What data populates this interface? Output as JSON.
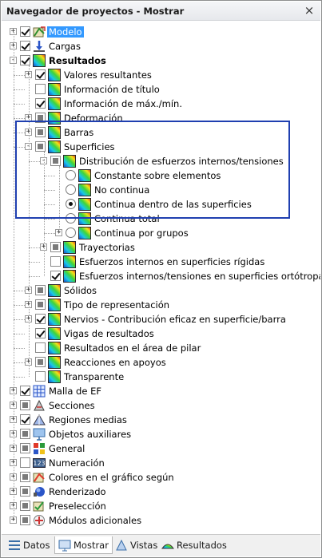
{
  "window": {
    "title": "Navegador de proyectos - Mostrar",
    "close_glyph": "×"
  },
  "tree": [
    {
      "label": "Modelo",
      "level": 0,
      "expander": "+",
      "check": "checked",
      "icon": "model-icon",
      "selected": true
    },
    {
      "label": "Cargas",
      "level": 0,
      "expander": "+",
      "check": "checked",
      "icon": "loads-icon"
    },
    {
      "label": "Resultados",
      "level": 0,
      "expander": "-",
      "check": "checked",
      "icon": "results-icon",
      "bold": true
    },
    {
      "label": "Valores resultantes",
      "level": 1,
      "expander": "+",
      "check": "checked",
      "icon": "rainbow-icon"
    },
    {
      "label": "Información de título",
      "level": 1,
      "expander": "",
      "check": "unchecked",
      "icon": "rainbow-icon"
    },
    {
      "label": "Información de máx./mín.",
      "level": 1,
      "expander": "",
      "check": "checked",
      "icon": "rainbow-icon"
    },
    {
      "label": "Deformación",
      "level": 1,
      "expander": "+",
      "check": "partial",
      "icon": "rainbow-icon"
    },
    {
      "label": "Barras",
      "level": 1,
      "expander": "+",
      "check": "partial",
      "icon": "rainbow-icon"
    },
    {
      "label": "Superficies",
      "level": 1,
      "expander": "-",
      "check": "partial",
      "icon": "rainbow-icon"
    },
    {
      "label": "Distribución de esfuerzos internos/tensiones",
      "level": 2,
      "expander": "-",
      "check": "partial",
      "icon": "rainbow-icon"
    },
    {
      "label": "Constante sobre elementos",
      "level": 3,
      "expander": "",
      "radio": "off",
      "icon": "rainbow-icon"
    },
    {
      "label": "No continua",
      "level": 3,
      "expander": "",
      "radio": "off",
      "icon": "rainbow-icon"
    },
    {
      "label": "Continua dentro de las superficies",
      "level": 3,
      "expander": "",
      "radio": "on",
      "icon": "rainbow-icon"
    },
    {
      "label": "Continua total",
      "level": 3,
      "expander": "",
      "radio": "off",
      "icon": "rainbow-icon"
    },
    {
      "label": "Continua por grupos",
      "level": 3,
      "expander": "+",
      "radio": "off",
      "icon": "rainbow-icon"
    },
    {
      "label": "Trayectorias",
      "level": 2,
      "expander": "+",
      "check": "partial",
      "icon": "rainbow-icon"
    },
    {
      "label": "Esfuerzos internos en superficies rígidas",
      "level": 2,
      "expander": "",
      "check": "unchecked",
      "icon": "rainbow-icon"
    },
    {
      "label": "Esfuerzos internos/tensiones en superficies ortótropas",
      "level": 2,
      "expander": "",
      "check": "checked",
      "icon": "rainbow-icon"
    },
    {
      "label": "Sólidos",
      "level": 1,
      "expander": "+",
      "check": "partial",
      "icon": "rainbow-icon"
    },
    {
      "label": "Tipo de representación",
      "level": 1,
      "expander": "+",
      "check": "partial",
      "icon": "rainbow-icon"
    },
    {
      "label": "Nervios - Contribución eficaz en superficie/barra",
      "level": 1,
      "expander": "+",
      "check": "checked",
      "icon": "rainbow-icon"
    },
    {
      "label": "Vigas de resultados",
      "level": 1,
      "expander": "",
      "check": "checked",
      "icon": "rainbow-icon"
    },
    {
      "label": "Resultados en el área de pilar",
      "level": 1,
      "expander": "",
      "check": "unchecked",
      "icon": "rainbow-icon"
    },
    {
      "label": "Reacciones en apoyos",
      "level": 1,
      "expander": "+",
      "check": "partial",
      "icon": "rainbow-icon"
    },
    {
      "label": "Transparente",
      "level": 1,
      "expander": "",
      "check": "unchecked",
      "icon": "rainbow-icon"
    },
    {
      "label": "Malla de EF",
      "level": 0,
      "expander": "+",
      "check": "checked",
      "icon": "mesh-icon"
    },
    {
      "label": "Secciones",
      "level": 0,
      "expander": "+",
      "check": "partial",
      "icon": "section-icon"
    },
    {
      "label": "Regiones medias",
      "level": 0,
      "expander": "+",
      "check": "checked",
      "icon": "region-icon"
    },
    {
      "label": "Objetos auxiliares",
      "level": 0,
      "expander": "+",
      "check": "partial",
      "icon": "aux-icon"
    },
    {
      "label": "General",
      "level": 0,
      "expander": "+",
      "check": "partial",
      "icon": "general-icon"
    },
    {
      "label": "Numeración",
      "level": 0,
      "expander": "+",
      "check": "unchecked",
      "icon": "numbering-icon"
    },
    {
      "label": "Colores en el gráfico según",
      "level": 0,
      "expander": "+",
      "check": "partial",
      "icon": "colors-icon"
    },
    {
      "label": "Renderizado",
      "level": 0,
      "expander": "+",
      "check": "partial",
      "icon": "render-icon"
    },
    {
      "label": "Preselección",
      "level": 0,
      "expander": "+",
      "check": "partial",
      "icon": "preselect-icon"
    },
    {
      "label": "Módulos adicionales",
      "level": 0,
      "expander": "+",
      "check": "partial",
      "icon": "modules-icon"
    }
  ],
  "tabs": [
    {
      "label": "Datos",
      "icon": "data-icon",
      "active": false
    },
    {
      "label": "Mostrar",
      "icon": "display-icon",
      "active": true
    },
    {
      "label": "Vistas",
      "icon": "views-icon",
      "active": false
    },
    {
      "label": "Resultados",
      "icon": "results-tab-icon",
      "active": false
    }
  ],
  "colors": {
    "selection": "#3399ff",
    "highlight_border": "#1f3fb0"
  }
}
